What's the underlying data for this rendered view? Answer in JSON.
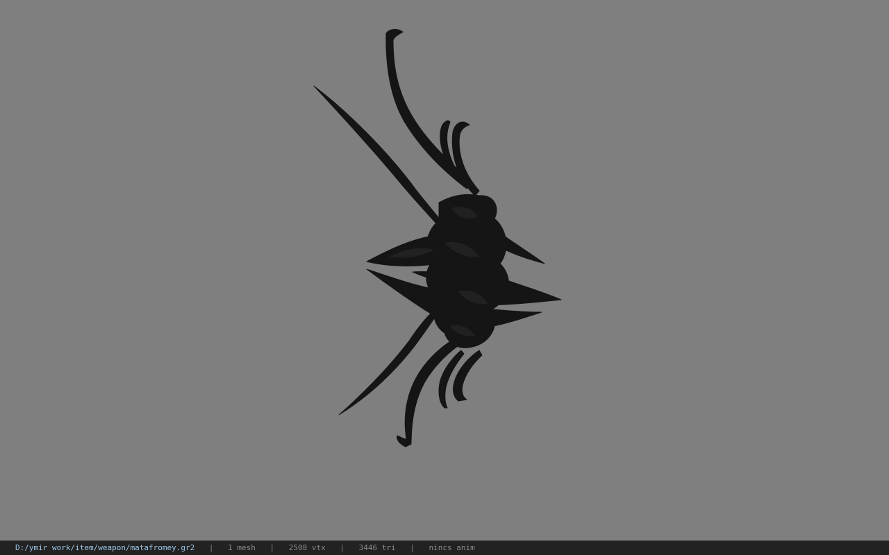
{
  "viewport": {
    "background_color": "#7f7f7f",
    "model_color": "#151515"
  },
  "status": {
    "file_path": "D:/ymir work/item/weapon/matafromey.gr2",
    "mesh_count": "1 mesh",
    "vertex_count": "2508 vtx",
    "triangle_count": "3446 tri",
    "animation": "nincs anim",
    "separator": "|",
    "path_color": "#9cc6e8"
  }
}
